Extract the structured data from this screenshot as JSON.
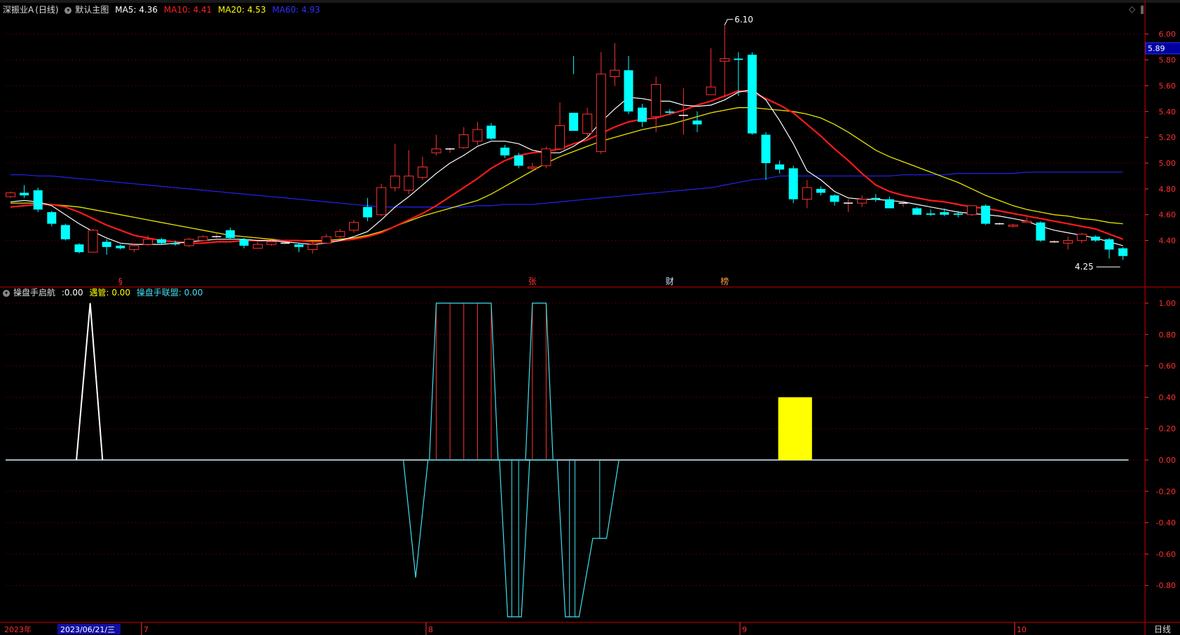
{
  "main_header": {
    "stock_name": "深振业A",
    "period": "(日线)",
    "template": "默认主图",
    "ma": [
      {
        "label": "MA5:",
        "value": "4.36",
        "color": "#ffffff"
      },
      {
        "label": "MA10:",
        "value": "4.41",
        "color": "#ff2020"
      },
      {
        "label": "MA20:",
        "value": "4.53",
        "color": "#ffff00"
      },
      {
        "label": "MA60:",
        "value": "4.93",
        "color": "#3030ff"
      }
    ]
  },
  "sub_header": {
    "indicator": "操盘手启航",
    "items": [
      {
        "label": ":",
        "value": "0.00",
        "color": "#ffffff"
      },
      {
        "label": "遇管:",
        "value": "0.00",
        "color": "#ffff00"
      },
      {
        "label": "操盘手联盟:",
        "value": "0.00",
        "color": "#40e0f0"
      }
    ]
  },
  "price_axis": {
    "ticks": [
      "6.00",
      "5.80",
      "5.60",
      "5.40",
      "5.20",
      "5.00",
      "4.80",
      "4.60",
      "4.40"
    ],
    "current_price": "5.89"
  },
  "sub_axis": {
    "ticks": [
      "1.00",
      "0.80",
      "0.60",
      "0.40",
      "0.20",
      "0.00",
      "-0.20",
      "-0.40",
      "-0.60",
      "-0.80"
    ]
  },
  "annotations": {
    "high_label": "6.10",
    "low_label": "4.25",
    "event_markers": [
      {
        "text": "§",
        "color": "#ff3030"
      },
      {
        "text": "张",
        "color": "#ff3030"
      },
      {
        "text": "财",
        "color": "#cfe0ff"
      },
      {
        "text": "榜",
        "color": "#ffa040"
      }
    ]
  },
  "time_axis": {
    "year_label": "2023年",
    "cursor_date": "2023/06/21/三",
    "months": [
      "7",
      "8",
      "9",
      "10"
    ],
    "period_button": "日线"
  },
  "colors": {
    "up": "#ff3030",
    "down": "#00ffff",
    "ma5": "#ffffff",
    "ma10": "#ff1a1a",
    "ma20": "#e6e600",
    "ma60": "#2020e0",
    "grid": "#8b0000",
    "axis_text": "#ff3030"
  },
  "chart_data": {
    "type": "candlestick",
    "price_range": [
      4.25,
      6.1
    ],
    "sub_range": [
      -1,
      1
    ],
    "candles": [
      [
        4.74,
        4.77,
        4.78,
        4.73
      ],
      [
        4.77,
        4.75,
        4.83,
        4.73
      ],
      [
        4.79,
        4.64,
        4.81,
        4.62
      ],
      [
        4.62,
        4.53,
        4.63,
        4.51
      ],
      [
        4.52,
        4.41,
        4.53,
        4.4
      ],
      [
        4.37,
        4.31,
        4.38,
        4.3
      ],
      [
        4.31,
        4.48,
        4.49,
        4.31
      ],
      [
        4.39,
        4.35,
        4.41,
        4.29
      ],
      [
        4.36,
        4.34,
        4.37,
        4.33
      ],
      [
        4.33,
        4.36,
        4.38,
        4.31
      ],
      [
        4.37,
        4.41,
        4.44,
        4.36
      ],
      [
        4.41,
        4.38,
        4.42,
        4.37
      ],
      [
        4.38,
        4.37,
        4.4,
        4.36
      ],
      [
        4.36,
        4.41,
        4.42,
        4.35
      ],
      [
        4.4,
        4.43,
        4.44,
        4.39
      ],
      [
        4.43,
        4.43,
        4.46,
        4.42
      ],
      [
        4.48,
        4.42,
        4.5,
        4.41
      ],
      [
        4.41,
        4.36,
        4.42,
        4.34
      ],
      [
        4.34,
        4.37,
        4.39,
        4.34
      ],
      [
        4.37,
        4.39,
        4.4,
        4.36
      ],
      [
        4.38,
        4.38,
        4.39,
        4.37
      ],
      [
        4.37,
        4.35,
        4.38,
        4.31
      ],
      [
        4.33,
        4.37,
        4.39,
        4.3
      ],
      [
        4.38,
        4.43,
        4.45,
        4.38
      ],
      [
        4.43,
        4.47,
        4.49,
        4.42
      ],
      [
        4.48,
        4.54,
        4.56,
        4.46
      ],
      [
        4.66,
        4.58,
        4.73,
        4.55
      ],
      [
        4.6,
        4.81,
        4.84,
        4.59
      ],
      [
        4.81,
        4.9,
        5.15,
        4.78
      ],
      [
        4.79,
        4.9,
        5.1,
        4.76
      ],
      [
        4.89,
        4.97,
        5.05,
        4.87
      ],
      [
        5.08,
        5.11,
        5.22,
        5.06
      ],
      [
        5.11,
        5.11,
        5.12,
        5.08
      ],
      [
        5.12,
        5.22,
        5.28,
        5.11
      ],
      [
        5.17,
        5.26,
        5.32,
        5.14
      ],
      [
        5.29,
        5.19,
        5.31,
        5.18
      ],
      [
        5.12,
        5.06,
        5.14,
        5.04
      ],
      [
        5.06,
        4.98,
        5.08,
        4.96
      ],
      [
        4.96,
        4.97,
        5.0,
        4.94
      ],
      [
        4.98,
        5.11,
        5.13,
        4.96
      ],
      [
        5.11,
        5.29,
        5.47,
        5.1
      ],
      [
        5.39,
        5.25,
        5.83,
        5.69
      ],
      [
        5.23,
        5.38,
        5.43,
        5.2
      ],
      [
        5.09,
        5.69,
        5.86,
        5.07
      ],
      [
        5.67,
        5.72,
        5.93,
        5.6
      ],
      [
        5.72,
        5.4,
        5.83,
        5.38
      ],
      [
        5.43,
        5.32,
        5.46,
        5.28
      ],
      [
        5.36,
        5.61,
        5.67,
        5.24
      ],
      [
        5.4,
        5.39,
        5.42,
        5.38
      ],
      [
        5.37,
        5.37,
        5.58,
        5.22
      ],
      [
        5.33,
        5.3,
        5.4,
        5.24
      ],
      [
        5.53,
        5.59,
        5.89,
        5.54
      ],
      [
        5.79,
        5.81,
        6.07,
        5.51
      ],
      [
        5.81,
        5.8,
        5.86,
        5.52
      ],
      [
        5.84,
        5.23,
        5.86,
        5.22
      ],
      [
        5.22,
        5.0,
        5.24,
        4.87
      ],
      [
        4.99,
        4.95,
        5.02,
        4.92
      ],
      [
        4.96,
        4.72,
        4.98,
        4.69
      ],
      [
        4.72,
        4.81,
        4.87,
        4.65
      ],
      [
        4.8,
        4.77,
        4.82,
        4.75
      ],
      [
        4.75,
        4.7,
        4.76,
        4.67
      ],
      [
        4.69,
        4.69,
        4.72,
        4.62
      ],
      [
        4.69,
        4.72,
        4.75,
        4.66
      ],
      [
        4.73,
        4.72,
        4.76,
        4.7
      ],
      [
        4.72,
        4.65,
        4.74,
        4.65
      ],
      [
        4.69,
        4.69,
        4.71,
        4.66
      ],
      [
        4.65,
        4.6,
        4.66,
        4.6
      ],
      [
        4.61,
        4.6,
        4.64,
        4.59
      ],
      [
        4.62,
        4.6,
        4.65,
        4.59
      ],
      [
        4.61,
        4.6,
        4.63,
        4.58
      ],
      [
        4.6,
        4.67,
        4.67,
        4.59
      ],
      [
        4.67,
        4.53,
        4.68,
        4.52
      ],
      [
        4.53,
        4.53,
        4.54,
        4.52
      ],
      [
        4.51,
        4.52,
        4.53,
        4.5
      ],
      [
        4.54,
        4.55,
        4.58,
        4.54
      ],
      [
        4.54,
        4.4,
        4.55,
        4.39
      ],
      [
        4.39,
        4.39,
        4.4,
        4.38
      ],
      [
        4.38,
        4.4,
        4.43,
        4.33
      ],
      [
        4.4,
        4.45,
        4.46,
        4.38
      ],
      [
        4.43,
        4.4,
        4.44,
        4.39
      ],
      [
        4.41,
        4.33,
        4.42,
        4.26
      ],
      [
        4.34,
        4.28,
        4.35,
        4.25
      ]
    ],
    "ma5": [
      4.7,
      4.71,
      4.7,
      4.67,
      4.6,
      4.53,
      4.47,
      4.42,
      4.38,
      4.37,
      4.37,
      4.37,
      4.38,
      4.39,
      4.4,
      4.41,
      4.41,
      4.41,
      4.4,
      4.4,
      4.39,
      4.38,
      4.37,
      4.38,
      4.4,
      4.43,
      4.47,
      4.56,
      4.66,
      4.74,
      4.83,
      4.92,
      5.0,
      5.06,
      5.13,
      5.17,
      5.17,
      5.15,
      5.1,
      5.08,
      5.08,
      5.13,
      5.2,
      5.32,
      5.42,
      5.51,
      5.5,
      5.48,
      5.48,
      5.45,
      5.44,
      5.45,
      5.49,
      5.55,
      5.57,
      5.49,
      5.33,
      5.15,
      4.94,
      4.87,
      4.78,
      4.73,
      4.72,
      4.72,
      4.71,
      4.7,
      4.68,
      4.66,
      4.64,
      4.62,
      4.61,
      4.6,
      4.59,
      4.57,
      4.55,
      4.51,
      4.48,
      4.46,
      4.44,
      4.42,
      4.39,
      4.36
    ],
    "ma10": [
      4.66,
      4.67,
      4.68,
      4.68,
      4.66,
      4.62,
      4.57,
      4.52,
      4.48,
      4.44,
      4.42,
      4.4,
      4.39,
      4.38,
      4.38,
      4.39,
      4.39,
      4.4,
      4.4,
      4.4,
      4.4,
      4.4,
      4.39,
      4.39,
      4.4,
      4.41,
      4.43,
      4.46,
      4.51,
      4.56,
      4.61,
      4.67,
      4.74,
      4.81,
      4.88,
      4.96,
      5.02,
      5.06,
      5.08,
      5.09,
      5.11,
      5.15,
      5.18,
      5.23,
      5.28,
      5.32,
      5.34,
      5.35,
      5.38,
      5.41,
      5.45,
      5.48,
      5.52,
      5.56,
      5.55,
      5.5,
      5.45,
      5.39,
      5.3,
      5.21,
      5.11,
      5.02,
      4.92,
      4.83,
      4.78,
      4.75,
      4.73,
      4.71,
      4.7,
      4.68,
      4.66,
      4.65,
      4.63,
      4.61,
      4.59,
      4.57,
      4.55,
      4.53,
      4.51,
      4.49,
      4.45,
      4.41
    ],
    "ma20": [
      4.69,
      4.69,
      4.69,
      4.68,
      4.67,
      4.66,
      4.64,
      4.62,
      4.6,
      4.58,
      4.56,
      4.54,
      4.52,
      4.5,
      4.48,
      4.46,
      4.44,
      4.43,
      4.42,
      4.41,
      4.4,
      4.4,
      4.4,
      4.4,
      4.41,
      4.42,
      4.44,
      4.47,
      4.51,
      4.55,
      4.59,
      4.62,
      4.65,
      4.68,
      4.71,
      4.76,
      4.82,
      4.88,
      4.94,
      5.0,
      5.05,
      5.09,
      5.13,
      5.17,
      5.2,
      5.23,
      5.26,
      5.28,
      5.3,
      5.33,
      5.36,
      5.39,
      5.41,
      5.43,
      5.43,
      5.42,
      5.41,
      5.4,
      5.38,
      5.35,
      5.3,
      5.24,
      5.17,
      5.1,
      5.05,
      5.01,
      4.97,
      4.93,
      4.89,
      4.85,
      4.8,
      4.75,
      4.71,
      4.67,
      4.64,
      4.62,
      4.6,
      4.59,
      4.57,
      4.56,
      4.54,
      4.53
    ],
    "ma60": [
      4.91,
      4.91,
      4.9,
      4.9,
      4.89,
      4.88,
      4.87,
      4.86,
      4.85,
      4.84,
      4.83,
      4.82,
      4.81,
      4.8,
      4.79,
      4.78,
      4.77,
      4.76,
      4.75,
      4.74,
      4.73,
      4.72,
      4.71,
      4.7,
      4.69,
      4.68,
      4.67,
      4.66,
      4.66,
      4.66,
      4.66,
      4.66,
      4.66,
      4.66,
      4.67,
      4.67,
      4.68,
      4.68,
      4.68,
      4.69,
      4.7,
      4.71,
      4.72,
      4.73,
      4.74,
      4.75,
      4.76,
      4.77,
      4.78,
      4.79,
      4.8,
      4.81,
      4.83,
      4.85,
      4.87,
      4.88,
      4.9,
      4.9,
      4.9,
      4.9,
      4.9,
      4.9,
      4.9,
      4.9,
      4.9,
      4.91,
      4.91,
      4.91,
      4.91,
      4.92,
      4.92,
      4.92,
      4.92,
      4.92,
      4.93,
      4.93,
      4.93,
      4.93,
      4.93,
      4.93,
      4.93,
      4.93
    ],
    "sub_white": [
      [
        0,
        0
      ],
      [
        5,
        0
      ],
      [
        6,
        1
      ],
      [
        7,
        0
      ],
      [
        81,
        0
      ]
    ],
    "sub_cyan": [
      [
        29,
        0
      ],
      [
        30,
        -0.75
      ],
      [
        31,
        0
      ],
      [
        36,
        0
      ],
      [
        37,
        -1
      ],
      [
        38,
        -1
      ],
      [
        39,
        0
      ],
      [
        41,
        0
      ],
      [
        42,
        -1
      ],
      [
        43,
        -1
      ],
      [
        44,
        -0.5
      ],
      [
        45,
        -0.5
      ],
      [
        46,
        0
      ]
    ],
    "sub_red_bars": [
      31,
      32,
      33,
      34,
      35,
      38,
      39
    ],
    "sub_top_line": [
      [
        31,
        1
      ],
      [
        35,
        1
      ],
      [
        36,
        0
      ],
      [
        38,
        0
      ],
      [
        39,
        1
      ],
      [
        40,
        1
      ],
      [
        40,
        0
      ]
    ],
    "sub_yellow_box": {
      "start": 56,
      "end": 58,
      "value": 0.4
    }
  }
}
